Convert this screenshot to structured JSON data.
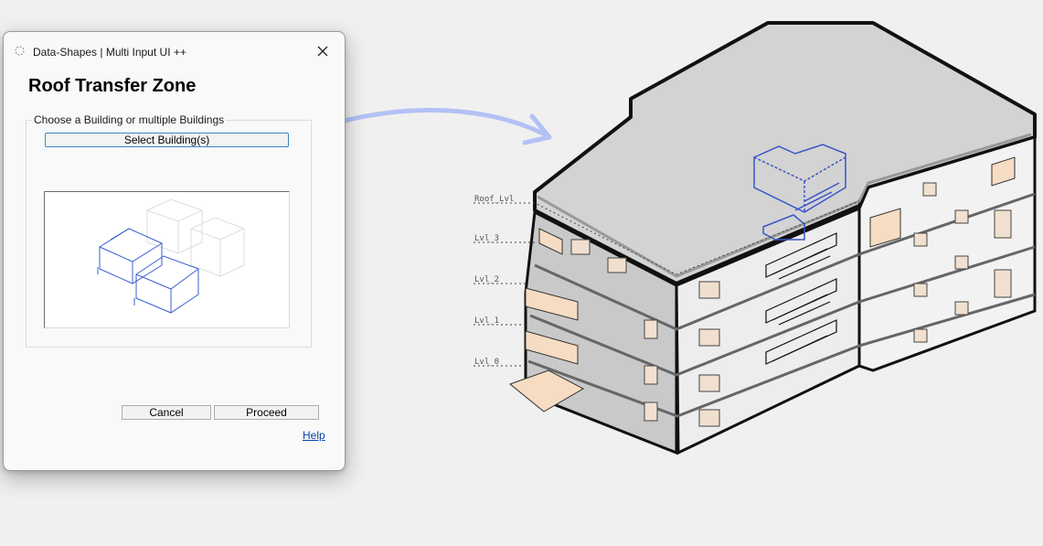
{
  "dialog": {
    "window_title": "Data-Shapes | Multi Input UI ++",
    "heading": "Roof Transfer Zone",
    "group_label": "Choose a Building or multiple Buildings",
    "select_button_label": "Select Building(s)",
    "cancel_label": "Cancel",
    "proceed_label": "Proceed",
    "help_label": "Help"
  },
  "illustration": {
    "levels": [
      "Roof_Lvl",
      "Lvl_3",
      "Lvl_2",
      "Lvl_1",
      "Lvl_0"
    ]
  },
  "colors": {
    "accent_blue": "#3c84c7",
    "arrow": "#b3c1f5",
    "selection_blue": "#3a55c8",
    "link": "#0645ad"
  }
}
